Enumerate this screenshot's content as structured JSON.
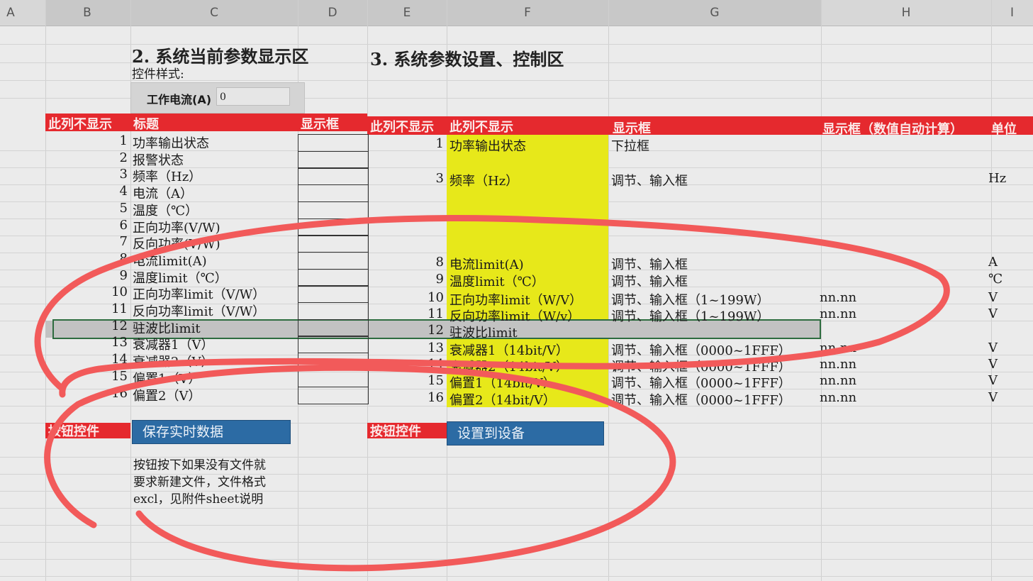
{
  "columns": [
    "A",
    "B",
    "C",
    "D",
    "E",
    "F",
    "G",
    "H",
    "I"
  ],
  "section2": {
    "title": "2. 系统当前参数显示区",
    "style_label": "控件样式:",
    "control_label": "工作电流(A)",
    "control_value": "0"
  },
  "section3": {
    "title": "3. 系统参数设置、控制区"
  },
  "headers": {
    "b": "此列不显示",
    "c": "标题",
    "d": "显示框",
    "e": "此列不显示",
    "f": "此列不显示",
    "g": "显示框",
    "h": "显示框（数值自动计算）",
    "i": "单位"
  },
  "left_rows": [
    {
      "n": "1",
      "label": "功率输出状态"
    },
    {
      "n": "2",
      "label": "报警状态"
    },
    {
      "n": "3",
      "label": "频率（Hz）"
    },
    {
      "n": "4",
      "label": "电流（A）"
    },
    {
      "n": "5",
      "label": "温度（℃）"
    },
    {
      "n": "6",
      "label": "正向功率(V/W)"
    },
    {
      "n": "7",
      "label": "反向功率(V/W)"
    },
    {
      "n": "8",
      "label": "电流limit(A)"
    },
    {
      "n": "9",
      "label": "温度limit（℃）"
    },
    {
      "n": "10",
      "label": "正向功率limit（V/W）"
    },
    {
      "n": "11",
      "label": "反向功率limit（V/W）"
    },
    {
      "n": "12",
      "label": "驻波比limit"
    },
    {
      "n": "13",
      "label": "衰减器1（V）"
    },
    {
      "n": "14",
      "label": "衰减器2（V）"
    },
    {
      "n": "15",
      "label": "偏置1（V）"
    },
    {
      "n": "16",
      "label": "偏置2（V）"
    }
  ],
  "right_rows": [
    {
      "n": "1",
      "label": "功率输出状态",
      "ctrl": "下拉框",
      "calc": "",
      "unit": ""
    },
    {
      "n": "3",
      "label": "频率（Hz）",
      "ctrl": "调节、输入框",
      "calc": "",
      "unit": "Hz"
    },
    {
      "n": "8",
      "label": "电流limit(A)",
      "ctrl": "调节、输入框",
      "calc": "",
      "unit": "A"
    },
    {
      "n": "9",
      "label": "温度limit（℃）",
      "ctrl": "调节、输入框",
      "calc": "",
      "unit": "℃"
    },
    {
      "n": "10",
      "label": "正向功率limit（W/V）",
      "ctrl": "调节、输入框（1~199W）",
      "calc": "nn.nn",
      "unit": "V"
    },
    {
      "n": "11",
      "label": "反向功率limit（W/v）",
      "ctrl": "调节、输入框（1~199W）",
      "calc": "nn.nn",
      "unit": "V"
    },
    {
      "n": "12",
      "label": "驻波比limit",
      "ctrl": "",
      "calc": "",
      "unit": ""
    },
    {
      "n": "13",
      "label": "衰减器1（14bit/V）",
      "ctrl": "调节、输入框（0000~1FFF）",
      "calc": "nn.nn",
      "unit": "V"
    },
    {
      "n": "14",
      "label": "衰减器2（14bit/V）",
      "ctrl": "调节、输入框（0000~1FFF）",
      "calc": "nn.nn",
      "unit": "V"
    },
    {
      "n": "15",
      "label": "偏置1（14bit/V）",
      "ctrl": "调节、输入框（0000~1FFF）",
      "calc": "nn.nn",
      "unit": "V"
    },
    {
      "n": "16",
      "label": "偏置2（14bit/V）",
      "ctrl": "调节、输入框（0000~1FFF）",
      "calc": "nn.nn",
      "unit": "V"
    }
  ],
  "buttons": {
    "left_label": "按钮控件",
    "save": "保存实时数据",
    "right_label": "按钮控件",
    "set": "设置到设备"
  },
  "note": {
    "line1": "按钮按下如果没有文件就",
    "line2": "要求新建文件，文件格式",
    "line3": "excl，见附件sheet说明"
  },
  "colors": {
    "header_red": "#e5292e",
    "highlight_yellow": "#e7e81a",
    "button_blue": "#2c6ba4",
    "annotation_red": "#f25a5a"
  }
}
